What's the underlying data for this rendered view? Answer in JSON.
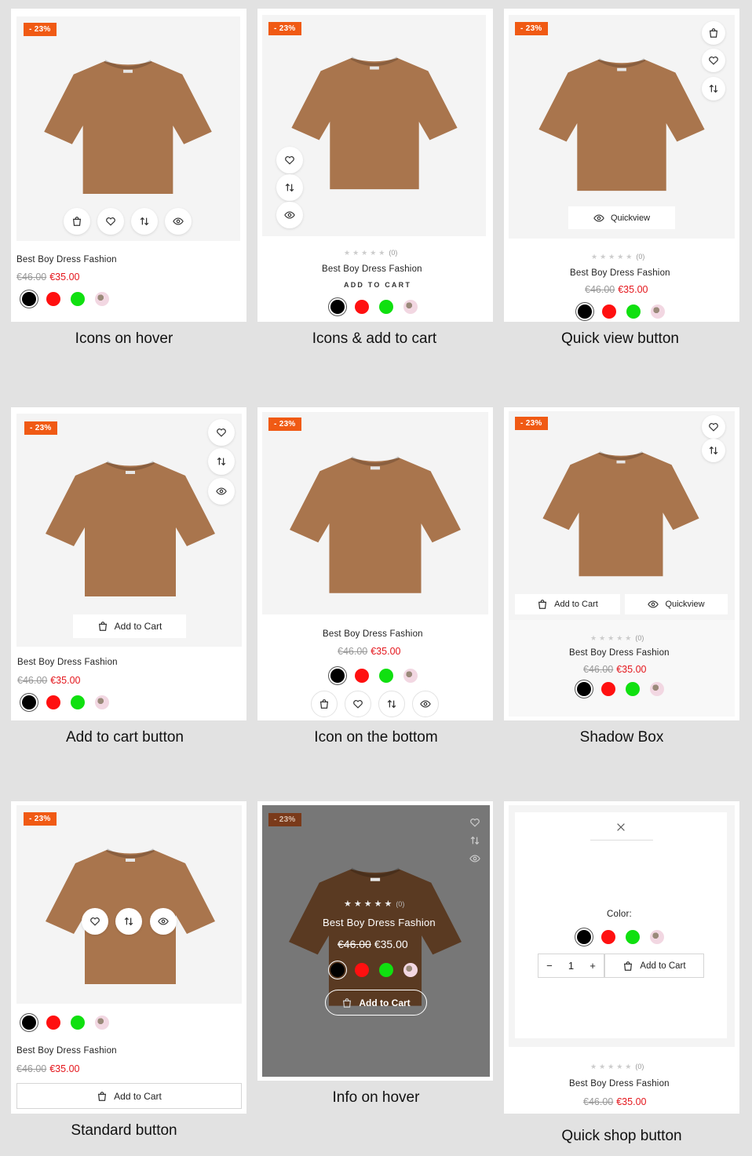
{
  "product": {
    "name": "Best Boy Dress Fashion",
    "old_price": "€46.00",
    "new_price": "€35.00",
    "discount": "- 23%",
    "rating_count": "(0)",
    "shirt_color": "#a9754d"
  },
  "captions": {
    "c1": "Icons on hover",
    "c2": "Icons & add to cart",
    "c3": "Quick view button",
    "c4": "Add to cart button",
    "c5": "Icon on the bottom",
    "c6": "Shadow Box",
    "c7": "Standard button",
    "c8": "Info on hover",
    "c9": "Quick shop button"
  },
  "labels": {
    "add_to_cart_caps": "ADD TO CART",
    "add_to_cart": "Add to Cart",
    "quickview": "Quickview",
    "color": "Color:",
    "qty": "1",
    "minus": "−",
    "plus": "+"
  },
  "swatch_colors": [
    "black",
    "red",
    "green",
    "pattern"
  ],
  "icons": [
    "bag-icon",
    "heart-icon",
    "compare-icon",
    "eye-icon",
    "close-icon"
  ]
}
